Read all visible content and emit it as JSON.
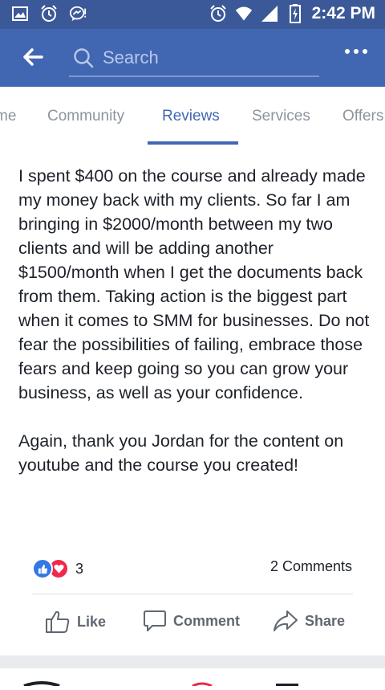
{
  "status_bar": {
    "time": "2:42 PM",
    "icons": [
      "image-icon",
      "alarm-icon",
      "messenger-icon",
      "alarm-icon",
      "wifi-icon",
      "signal-icon",
      "battery-icon"
    ]
  },
  "header": {
    "search_placeholder": "Search",
    "colors": {
      "bar": "#4267b2",
      "status": "#3b5998"
    }
  },
  "tabs": [
    {
      "label": "me"
    },
    {
      "label": "Community"
    },
    {
      "label": "Reviews",
      "active": true
    },
    {
      "label": "Services"
    },
    {
      "label": "Offers"
    }
  ],
  "post": {
    "paragraphs": [
      "I spent $400 on the course and already made my money back with my clients. So far I am bringing in $2000/month between my two clients and will be adding another $1500/month when I get the documents back from them. Taking action is the biggest part when it comes to SMM for businesses. Do not fear the possibilities of failing, embrace those fears and keep going so you can grow your business, as well as your confidence.",
      "Again, thank you Jordan for the content on youtube and the course you created!"
    ],
    "reaction_count": "3",
    "comments_label": "2 Comments",
    "actions": {
      "like": "Like",
      "comment": "Comment",
      "share": "Share"
    }
  }
}
